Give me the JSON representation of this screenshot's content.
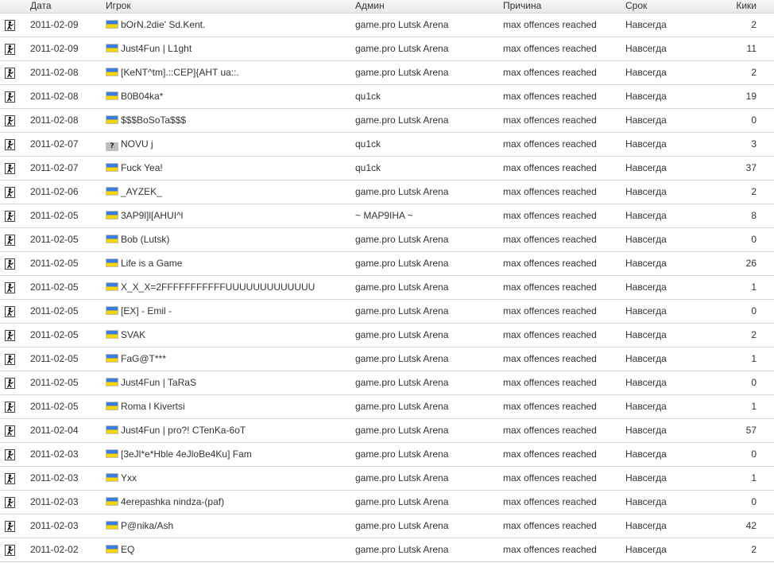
{
  "headers": {
    "date": "Дата",
    "player": "Игрок",
    "admin": "Админ",
    "reason": "Причина",
    "term": "Срок",
    "kicks": "Кики"
  },
  "rows": [
    {
      "date": "2011-02-09",
      "flag": "ua",
      "player": "bOrN.2die' Sd.Kent.",
      "admin": "game.pro Lutsk Arena",
      "reason": "max offences reached",
      "term": "Навсегда",
      "kicks": "2"
    },
    {
      "date": "2011-02-09",
      "flag": "ua",
      "player": "Just4Fun | L1ght",
      "admin": "game.pro Lutsk Arena",
      "reason": "max offences reached",
      "term": "Навсегда",
      "kicks": "11"
    },
    {
      "date": "2011-02-08",
      "flag": "ua",
      "player": "[KeNT^tm].::CEP]{AHT ua::.",
      "admin": "game.pro Lutsk Arena",
      "reason": "max offences reached",
      "term": "Навсегда",
      "kicks": "2"
    },
    {
      "date": "2011-02-08",
      "flag": "ua",
      "player": "B0B04ka*",
      "admin": "qu1ck",
      "reason": "max offences reached",
      "term": "Навсегда",
      "kicks": "19"
    },
    {
      "date": "2011-02-08",
      "flag": "ua",
      "player": "$$$BoSoTa$$$",
      "admin": "game.pro Lutsk Arena",
      "reason": "max offences reached",
      "term": "Навсегда",
      "kicks": "0"
    },
    {
      "date": "2011-02-07",
      "flag": "unknown",
      "player": "NOVU j",
      "admin": "qu1ck",
      "reason": "max offences reached",
      "term": "Навсегда",
      "kicks": "3"
    },
    {
      "date": "2011-02-07",
      "flag": "ua",
      "player": "Fuck Yea!",
      "admin": "qu1ck",
      "reason": "max offences reached",
      "term": "Навсегда",
      "kicks": "37"
    },
    {
      "date": "2011-02-06",
      "flag": "ua",
      "player": "_AYZEK_",
      "admin": "game.pro Lutsk Arena",
      "reason": "max offences reached",
      "term": "Навсегда",
      "kicks": "2"
    },
    {
      "date": "2011-02-05",
      "flag": "ua",
      "player": "3AP9l]l[AHUI^l",
      "admin": "~ MAP9IHA ~",
      "reason": "max offences reached",
      "term": "Навсегда",
      "kicks": "8"
    },
    {
      "date": "2011-02-05",
      "flag": "ua",
      "player": "Bob (Lutsk)",
      "admin": "game.pro Lutsk Arena",
      "reason": "max offences reached",
      "term": "Навсегда",
      "kicks": "0"
    },
    {
      "date": "2011-02-05",
      "flag": "ua",
      "player": "Life is a Game",
      "admin": "game.pro Lutsk Arena",
      "reason": "max offences reached",
      "term": "Навсегда",
      "kicks": "26"
    },
    {
      "date": "2011-02-05",
      "flag": "ua",
      "player": "X_X_X=2FFFFFFFFFFFUUUUUUUUUUUUU",
      "admin": "game.pro Lutsk Arena",
      "reason": "max offences reached",
      "term": "Навсегда",
      "kicks": "1"
    },
    {
      "date": "2011-02-05",
      "flag": "ua",
      "player": "[EX] - Emil -",
      "admin": "game.pro Lutsk Arena",
      "reason": "max offences reached",
      "term": "Навсегда",
      "kicks": "0"
    },
    {
      "date": "2011-02-05",
      "flag": "ua",
      "player": "SVAK",
      "admin": "game.pro Lutsk Arena",
      "reason": "max offences reached",
      "term": "Навсегда",
      "kicks": "2"
    },
    {
      "date": "2011-02-05",
      "flag": "ua",
      "player": "FaG@T***",
      "admin": "game.pro Lutsk Arena",
      "reason": "max offences reached",
      "term": "Навсегда",
      "kicks": "1"
    },
    {
      "date": "2011-02-05",
      "flag": "ua",
      "player": "Just4Fun | TaRaS",
      "admin": "game.pro Lutsk Arena",
      "reason": "max offences reached",
      "term": "Навсегда",
      "kicks": "0"
    },
    {
      "date": "2011-02-05",
      "flag": "ua",
      "player": "Roma l Kivertsi",
      "admin": "game.pro Lutsk Arena",
      "reason": "max offences reached",
      "term": "Навсегда",
      "kicks": "1"
    },
    {
      "date": "2011-02-04",
      "flag": "ua",
      "player": "Just4Fun | pro?! CTenKa-6oT",
      "admin": "game.pro Lutsk Arena",
      "reason": "max offences reached",
      "term": "Навсегда",
      "kicks": "57"
    },
    {
      "date": "2011-02-03",
      "flag": "ua",
      "player": "[3eJl*e*Hble 4eJloBe4Ku] Fam",
      "admin": "game.pro Lutsk Arena",
      "reason": "max offences reached",
      "term": "Навсегда",
      "kicks": "0"
    },
    {
      "date": "2011-02-03",
      "flag": "ua",
      "player": "Yxx",
      "admin": "game.pro Lutsk Arena",
      "reason": "max offences reached",
      "term": "Навсегда",
      "kicks": "1"
    },
    {
      "date": "2011-02-03",
      "flag": "ua",
      "player": "4erepashka nindza-(paf)",
      "admin": "game.pro Lutsk Arena",
      "reason": "max offences reached",
      "term": "Навсегда",
      "kicks": "0"
    },
    {
      "date": "2011-02-03",
      "flag": "ua",
      "player": "P@nika/Ash",
      "admin": "game.pro Lutsk Arena",
      "reason": "max offences reached",
      "term": "Навсегда",
      "kicks": "42"
    },
    {
      "date": "2011-02-02",
      "flag": "ua",
      "player": "EQ",
      "admin": "game.pro Lutsk Arena",
      "reason": "max offences reached",
      "term": "Навсегда",
      "kicks": "2"
    }
  ]
}
